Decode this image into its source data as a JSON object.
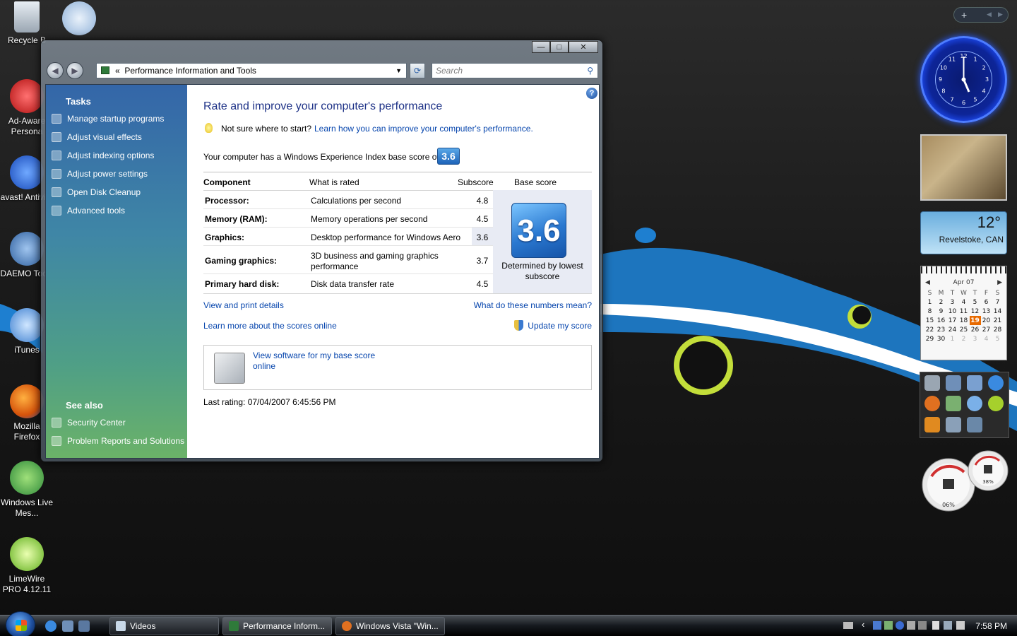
{
  "desktop": {
    "icons": [
      {
        "label": "Recycle B",
        "icon": "recycle-bin-icon"
      },
      {
        "label": "",
        "icon": "phone-icon"
      },
      {
        "label": "Ad-Aware Persona",
        "icon": "adaware-icon"
      },
      {
        "label": "avast! Antiviru",
        "icon": "avast-icon"
      },
      {
        "label": "DAEMO Tools",
        "icon": "daemon-tools-icon"
      },
      {
        "label": "iTunes",
        "icon": "itunes-icon"
      },
      {
        "label": "Mozilla Firefox",
        "icon": "firefox-icon"
      },
      {
        "label": "Windows Live Mes...",
        "icon": "messenger-icon"
      },
      {
        "label": "LimeWire PRO 4.12.11",
        "icon": "limewire-icon"
      }
    ]
  },
  "window": {
    "address": "Performance Information and Tools",
    "address_prefix": "«",
    "search_placeholder": "Search",
    "controls": {
      "minimize": "—",
      "maximize": "□",
      "close": "✕"
    },
    "back_glyph": "◀",
    "forward_glyph": "▶",
    "refresh_glyph": "⟳",
    "search_glyph": "⚲",
    "help": "?"
  },
  "sidebar": {
    "tasks_title": "Tasks",
    "tasks": [
      {
        "label": "Manage startup programs",
        "icon": "startup-icon"
      },
      {
        "label": "Adjust visual effects",
        "icon": "shield-icon"
      },
      {
        "label": "Adjust indexing options",
        "icon": "indexing-icon"
      },
      {
        "label": "Adjust power settings",
        "icon": "power-icon"
      },
      {
        "label": "Open Disk Cleanup",
        "icon": "disk-cleanup-icon"
      },
      {
        "label": "Advanced tools",
        "icon": "advanced-tools-icon"
      }
    ],
    "see_also_title": "See also",
    "see_also": [
      {
        "label": "Security Center",
        "icon": "security-center-icon"
      },
      {
        "label": "Problem Reports and Solutions",
        "icon": "problem-reports-icon"
      }
    ]
  },
  "main": {
    "heading": "Rate and improve your computer's performance",
    "tip_text": "Not sure where to start?",
    "tip_link": "Learn how you can improve your computer's performance.",
    "base_text": "Your computer has a Windows Experience Index base score of",
    "base_score": "3.6",
    "headers": {
      "component": "Component",
      "rated": "What is rated",
      "subscore": "Subscore",
      "base": "Base score"
    },
    "rows": [
      {
        "component": "Processor:",
        "rated": "Calculations per second",
        "subscore": "4.8"
      },
      {
        "component": "Memory (RAM):",
        "rated": "Memory operations per second",
        "subscore": "4.5"
      },
      {
        "component": "Graphics:",
        "rated": "Desktop performance for Windows Aero",
        "subscore": "3.6"
      },
      {
        "component": "Gaming graphics:",
        "rated": "3D business and gaming graphics performance",
        "subscore": "3.7"
      },
      {
        "component": "Primary hard disk:",
        "rated": "Disk data transfer rate",
        "subscore": "4.5"
      }
    ],
    "determined": "Determined by lowest subscore",
    "links": {
      "print": "View and print details",
      "numbers": "What do these numbers mean?",
      "learn": "Learn more about the scores online",
      "update": "Update my score"
    },
    "software_link": "View software for my base score online",
    "last_rating": "Last rating: 07/04/2007 6:45:56 PM"
  },
  "gadgets": {
    "weather_temp": "12°",
    "weather_city": "Revelstoke, CAN",
    "calendar_month": "Apr 07",
    "calendar_weekdays": [
      "S",
      "M",
      "T",
      "W",
      "T",
      "F",
      "S"
    ],
    "calendar_weeks": [
      [
        "1",
        "2",
        "3",
        "4",
        "5",
        "6",
        "7"
      ],
      [
        "8",
        "9",
        "10",
        "11",
        "12",
        "13",
        "14"
      ],
      [
        "15",
        "16",
        "17",
        "18",
        "19",
        "20",
        "21"
      ],
      [
        "22",
        "23",
        "24",
        "25",
        "26",
        "27",
        "28"
      ],
      [
        "29",
        "30",
        "1",
        "2",
        "3",
        "4",
        "5"
      ]
    ],
    "calendar_today": "19",
    "cpu_percent": "06%",
    "mem_percent": "38%",
    "clock_numerals": [
      "12",
      "1",
      "2",
      "3",
      "4",
      "5",
      "6",
      "7",
      "8",
      "9",
      "10",
      "11"
    ]
  },
  "taskbar": {
    "buttons": [
      {
        "label": "Videos",
        "icon": "folder-icon"
      },
      {
        "label": "Performance Inform...",
        "icon": "performance-icon"
      },
      {
        "label": "Windows Vista \"Win...",
        "icon": "firefox-icon"
      }
    ],
    "time": "7:58 PM"
  }
}
